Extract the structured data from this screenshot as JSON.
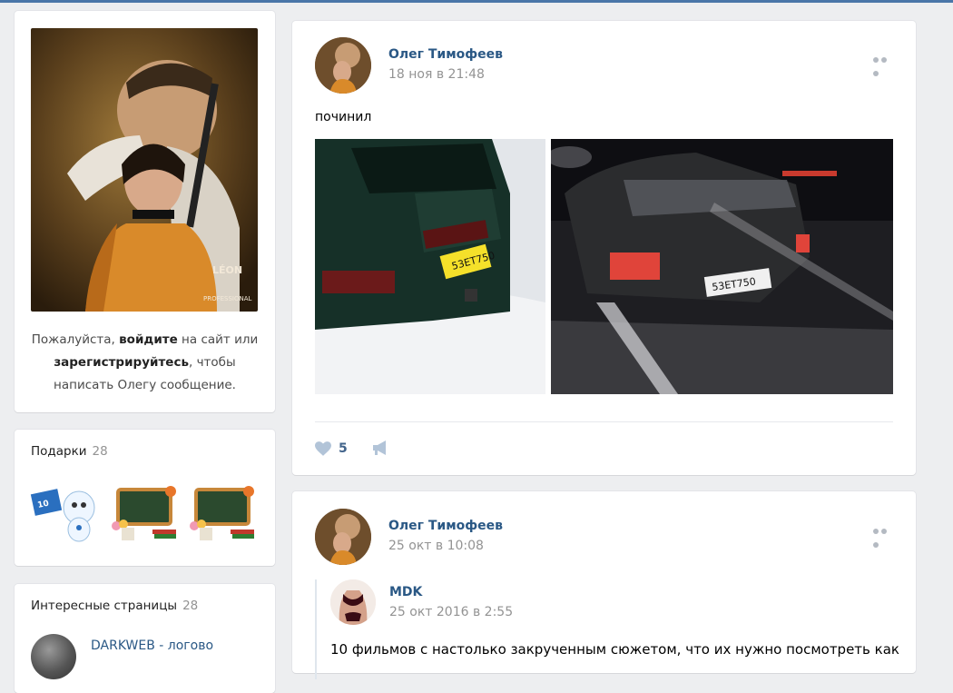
{
  "sidebar": {
    "login_prefix": "Пожалуйста, ",
    "login_link": "войдите",
    "login_middle": " на сайт или",
    "register_link": "зарегистрируйтесь",
    "login_suffix": ", чтобы написать Олегу сообщение.",
    "gifts_title": "Подарки",
    "gifts_count": "28",
    "pages_title": "Интересные страницы",
    "pages_count": "28",
    "page_name": "DARKWEB - логово"
  },
  "posts": [
    {
      "author": "Олег Тимофеев",
      "date": "18 ноя в 21:48",
      "text": "починил",
      "likes": "5"
    },
    {
      "author": "Олег Тимофеев",
      "date": "25 окт в 10:08",
      "repost_author": "MDK",
      "repost_date": "25 окт 2016 в 2:55",
      "text": "10 фильмов с настолько закрученным сюжетом, что их нужно посмотреть как"
    }
  ],
  "colors": {
    "accent": "#4a76a8",
    "link": "#2a5885",
    "background": "#edeef0"
  }
}
